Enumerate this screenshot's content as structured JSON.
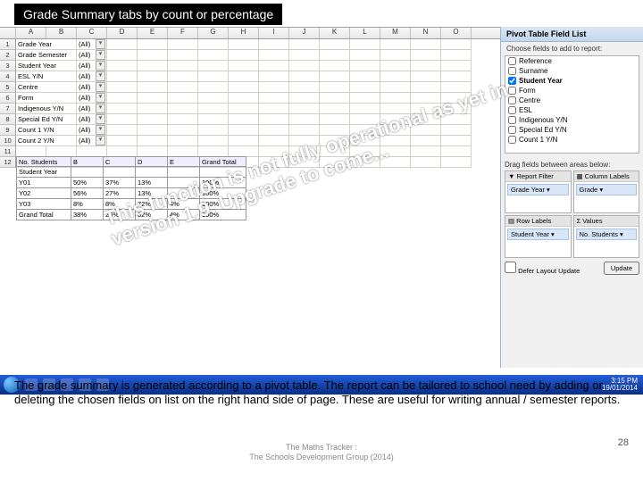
{
  "title": "Grade Summary tabs by count or percentage",
  "columns": [
    "A",
    "B",
    "C",
    "D",
    "E",
    "F",
    "G",
    "H",
    "I",
    "J",
    "K",
    "L",
    "M",
    "N",
    "O"
  ],
  "filter_rows": [
    {
      "num": "1",
      "label": "Grade Year",
      "val": "(All)"
    },
    {
      "num": "2",
      "label": "Grade Semester",
      "val": "(All)"
    },
    {
      "num": "3",
      "label": "Student Year",
      "val": "(All)"
    },
    {
      "num": "4",
      "label": "ESL Y/N",
      "val": "(All)"
    },
    {
      "num": "5",
      "label": "Centre",
      "val": "(All)"
    },
    {
      "num": "6",
      "label": "Form",
      "val": "(All)"
    },
    {
      "num": "7",
      "label": "Indigenous Y/N",
      "val": "(All)"
    },
    {
      "num": "8",
      "label": "Special Ed Y/N",
      "val": "(All)"
    },
    {
      "num": "9",
      "label": "Count 1 Y/N",
      "val": "(All)"
    },
    {
      "num": "10",
      "label": "Count 2 Y/N",
      "val": "(All)"
    }
  ],
  "empty_rows": [
    "11",
    "12"
  ],
  "pivot": {
    "header": [
      "No. Students",
      "B",
      "C",
      "D",
      "E",
      "Grand Total"
    ],
    "rows": [
      [
        "Student Year",
        "",
        "",
        "",
        "",
        ""
      ],
      [
        "Y01",
        "50%",
        "37%",
        "13%",
        "",
        "100%"
      ],
      [
        "Y02",
        "56%",
        "27%",
        "13%",
        "",
        "100%"
      ],
      [
        "Y03",
        "8%",
        "8%",
        "72%",
        "4%",
        "100%"
      ],
      [
        "Grand Total",
        "38%",
        "25%",
        "32%",
        "4%",
        "100%"
      ]
    ],
    "widths": [
      62,
      36,
      36,
      36,
      36,
      52
    ]
  },
  "field_pane": {
    "title": "Pivot Table Field List",
    "choose": "Choose fields to add to report:",
    "fields": [
      {
        "label": "Reference",
        "checked": false
      },
      {
        "label": "Surname",
        "checked": false
      },
      {
        "label": "Student Year",
        "checked": true
      },
      {
        "label": "Form",
        "checked": false
      },
      {
        "label": "Centre",
        "checked": false
      },
      {
        "label": "ESL",
        "checked": false
      },
      {
        "label": "Indigenous Y/N",
        "checked": false
      },
      {
        "label": "Special Ed Y/N",
        "checked": false
      },
      {
        "label": "Count 1 Y/N",
        "checked": false
      }
    ],
    "drag_label": "Drag fields between areas below:",
    "areas": {
      "report_filter": {
        "title": "▼ Report Filter",
        "items": [
          "Grade Year ▾"
        ]
      },
      "column_labels": {
        "title": "▦ Column Labels",
        "items": [
          "Grade ▾"
        ]
      },
      "row_labels": {
        "title": "▤ Row Labels",
        "items": [
          "Student Year ▾"
        ]
      },
      "values": {
        "title": "Σ Values",
        "items": [
          "No. Students ▾"
        ]
      }
    },
    "defer": "Defer Layout Update",
    "update": "Update"
  },
  "overlay": {
    "line1": "This function is not fully operational as yet in",
    "line2": "version 1.9.  Upgrade to come..."
  },
  "clock": {
    "time": "3:15 PM",
    "date": "19/01/2014"
  },
  "body": "The grade summary is generated according to a pivot table.  The report can be tailored to school need by adding or deleting the chosen fields on list on the right hand side of page.  These are useful for writing annual / semester reports.",
  "credit": {
    "l1": "The Maths Tracker :",
    "l2": "The Schools Development Group  (2014)"
  },
  "page_num": "28"
}
